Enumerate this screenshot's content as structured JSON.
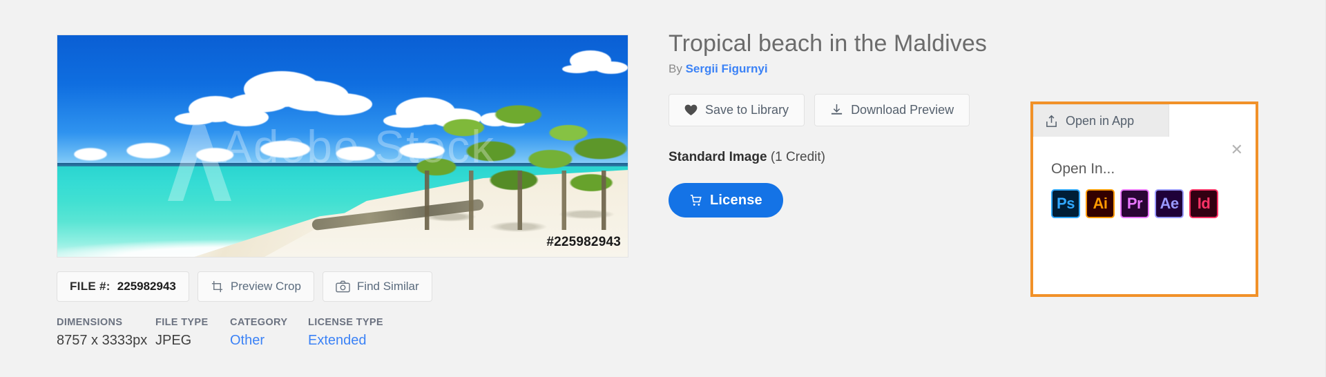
{
  "colors": {
    "page_bg": "#f2f2f2",
    "accent_blue": "#1473e6",
    "link_blue": "#3b82f6",
    "highlight_orange": "#f19128",
    "text_gray": "#6b6b6b"
  },
  "preview": {
    "alt": "Tropical beach in the Maldives preview",
    "watermark_text": "Adobe Stock",
    "watermark_logo_icon": "adobe-a-logo-icon",
    "file_number_overlay": "#225982943"
  },
  "image_actions": {
    "file_label": "FILE #:",
    "file_number": "225982943",
    "preview_crop_label": "Preview Crop",
    "preview_crop_icon": "crop-icon",
    "find_similar_label": "Find Similar",
    "find_similar_icon": "camera-icon"
  },
  "meta": [
    {
      "head": "DIMENSIONS",
      "value": "8757 x 3333px",
      "is_link": false
    },
    {
      "head": "FILE TYPE",
      "value": "JPEG",
      "is_link": false
    },
    {
      "head": "CATEGORY",
      "value": "Other",
      "is_link": true
    },
    {
      "head": "LICENSE TYPE",
      "value": "Extended",
      "is_link": true
    }
  ],
  "detail": {
    "title": "Tropical beach in the Maldives",
    "by_prefix": "By",
    "author": "Sergii Figurnyi",
    "save_label": "Save to Library",
    "save_icon": "heart-icon",
    "download_label": "Download Preview",
    "download_icon": "download-tray-icon",
    "license_type_name": "Standard Image",
    "license_credits": "(1 Credit)",
    "license_button_label": "License",
    "license_button_icon": "shopping-cart-icon"
  },
  "open_in_app": {
    "tab_label": "Open in App",
    "tab_icon": "share-upload-icon",
    "close_icon": "close-x-icon",
    "panel_label": "Open In...",
    "apps": [
      {
        "name": "Photoshop",
        "abbr": "Ps",
        "bg": "#001e36",
        "border": "#31a8ff",
        "fg": "#31a8ff"
      },
      {
        "name": "Illustrator",
        "abbr": "Ai",
        "bg": "#330000",
        "border": "#ff9a00",
        "fg": "#ff9a00"
      },
      {
        "name": "Premiere Pro",
        "abbr": "Pr",
        "bg": "#2a0634",
        "border": "#ea77ff",
        "fg": "#ea77ff"
      },
      {
        "name": "After Effects",
        "abbr": "Ae",
        "bg": "#1f0039",
        "border": "#9999ff",
        "fg": "#9999ff"
      },
      {
        "name": "InDesign",
        "abbr": "Id",
        "bg": "#330012",
        "border": "#ff3366",
        "fg": "#ff3366"
      }
    ]
  }
}
